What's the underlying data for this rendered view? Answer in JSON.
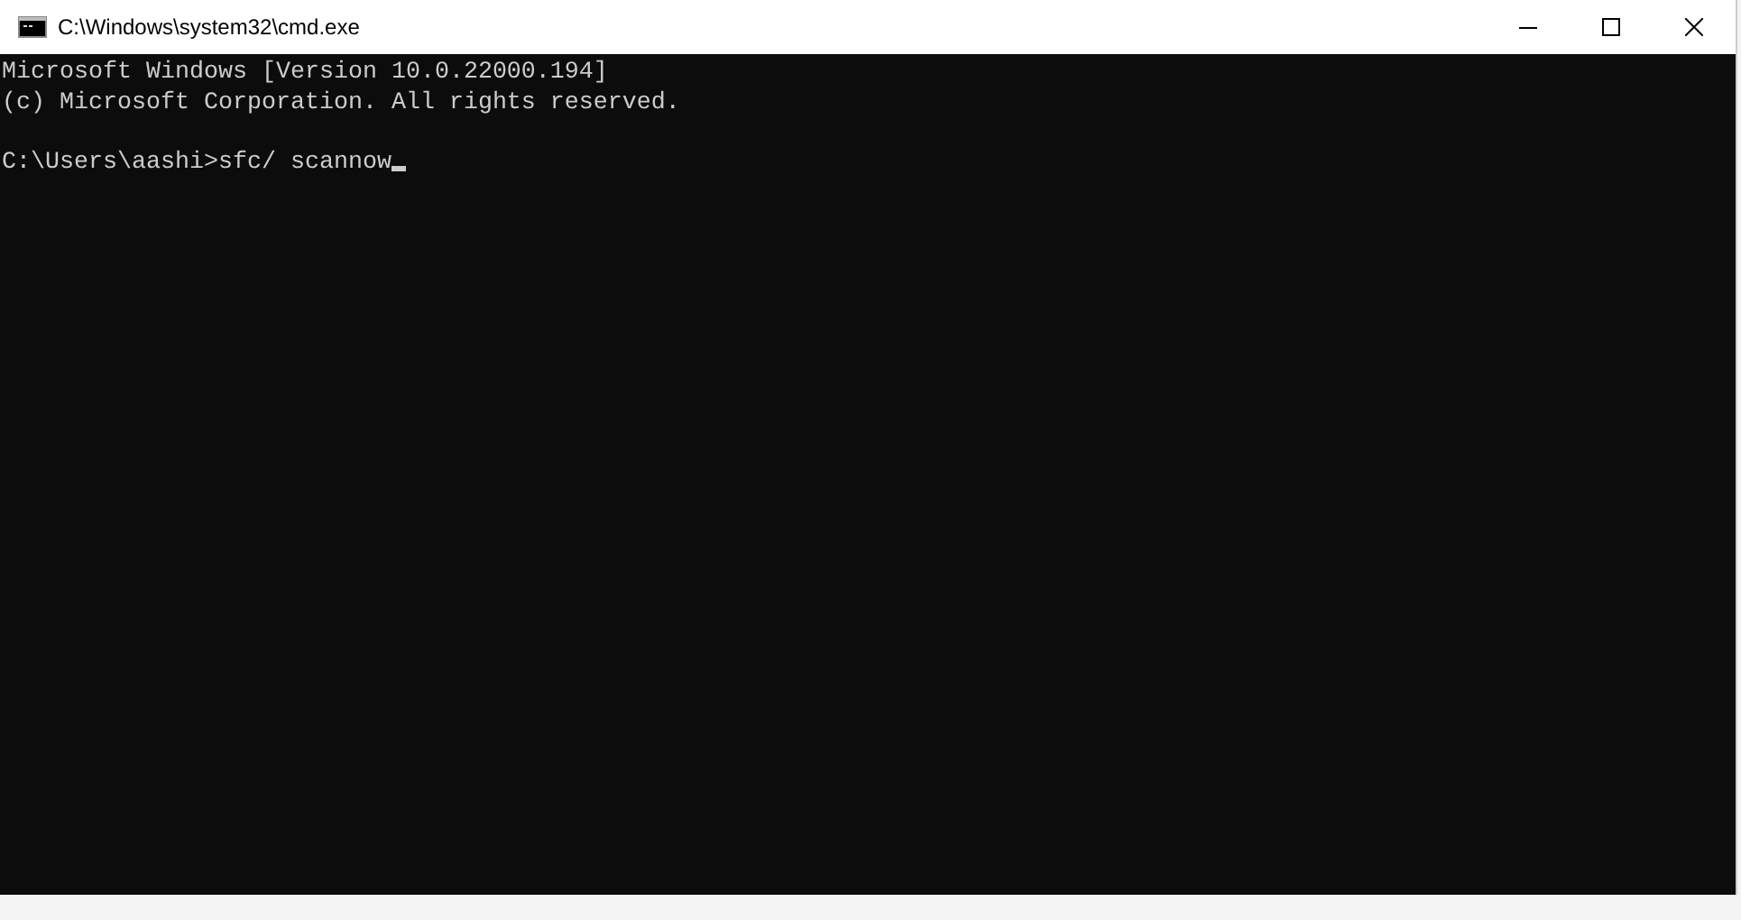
{
  "window": {
    "title": "C:\\Windows\\system32\\cmd.exe"
  },
  "console": {
    "output": [
      "Microsoft Windows [Version 10.0.22000.194]",
      "(c) Microsoft Corporation. All rights reserved."
    ],
    "prompt": "C:\\Users\\aashi>sfc/ scannow",
    "cursor": true
  }
}
